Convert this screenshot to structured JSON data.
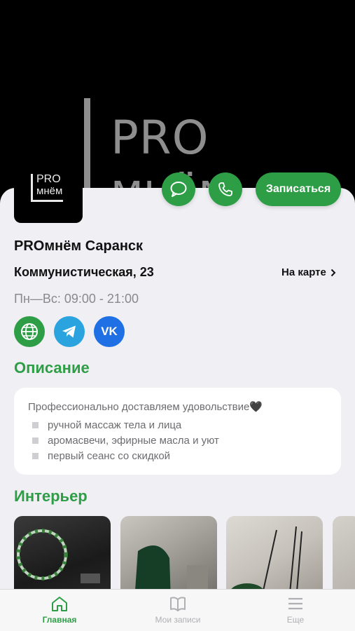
{
  "hero": {
    "logo_line1": "PRO",
    "logo_line2": "мнём"
  },
  "avatar": {
    "line1": "PRO",
    "line2": "мнём"
  },
  "actions": {
    "book_label": "Записаться"
  },
  "venue": {
    "name": "PROмнём Саранск",
    "address": "Коммунистическая, 23",
    "map_link": "На карте",
    "hours": "Пн—Вс: 09:00 - 21:00"
  },
  "social": {
    "vk_label": "VK"
  },
  "description": {
    "heading": "Описание",
    "intro": "Профессионально доставляем удовольствие🖤",
    "items": [
      "ручной массаж тела и лица",
      "аромасвечи, эфирные масла и уют",
      "первый сеанс со скидкой"
    ]
  },
  "interior": {
    "heading": "Интерьер"
  },
  "tabbar": {
    "home": "Главная",
    "records": "Мои записи",
    "more": "Еще"
  },
  "colors": {
    "accent": "#2e9e46",
    "telegram": "#2aa3df",
    "vk": "#1f6fe5"
  },
  "icons": [
    "chat-icon",
    "phone-icon",
    "chevron-right-icon",
    "globe-icon",
    "telegram-icon",
    "vk-icon",
    "home-icon",
    "book-icon",
    "menu-icon"
  ]
}
